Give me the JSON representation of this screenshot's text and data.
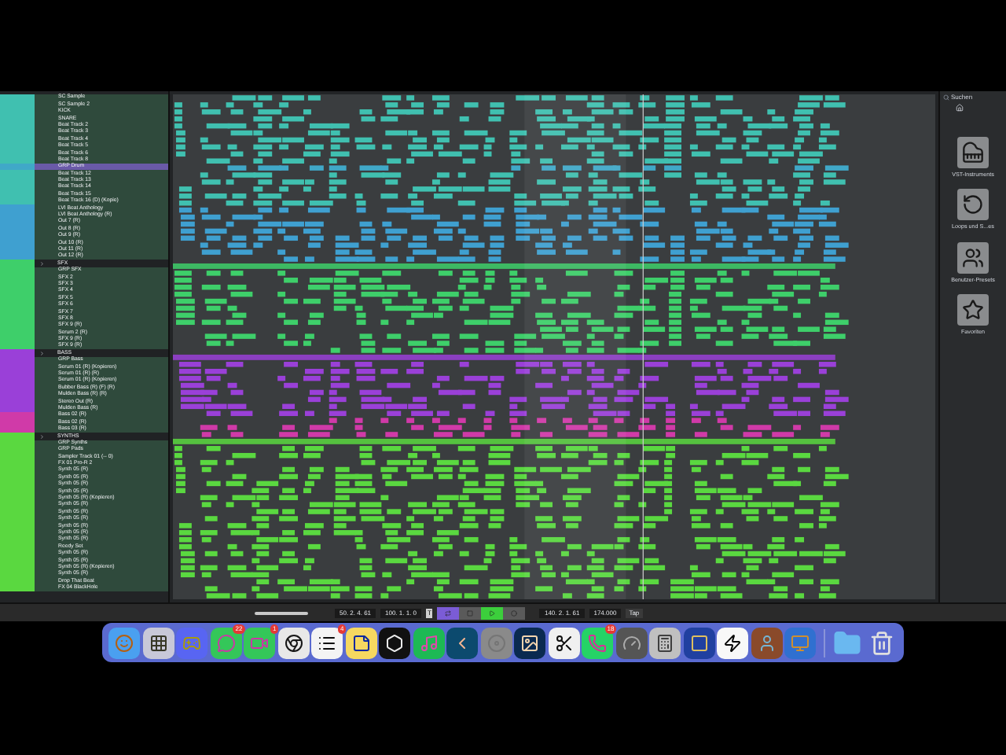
{
  "tracks": [
    {
      "name": "SC Sample",
      "kind": "track",
      "color": "#40c0b0",
      "selected": false
    },
    {
      "name": "SC Sample 2",
      "kind": "track",
      "color": "#40c0b0",
      "selected": false
    },
    {
      "name": "KICK",
      "kind": "track",
      "color": "#40c0b0",
      "selected": false
    },
    {
      "name": "SNARE",
      "kind": "track",
      "color": "#40c0b0",
      "selected": false
    },
    {
      "name": "Beat Track 2",
      "kind": "track",
      "color": "#40c0b0",
      "selected": false
    },
    {
      "name": "Beat Track 3",
      "kind": "track",
      "color": "#40c0b0",
      "selected": false
    },
    {
      "name": "Beat Track 4",
      "kind": "track",
      "color": "#40c0b0",
      "selected": false
    },
    {
      "name": "Beat Track 5",
      "kind": "track",
      "color": "#40c0b0",
      "selected": false
    },
    {
      "name": "Beat Track 6",
      "kind": "track",
      "color": "#40c0b0",
      "selected": false
    },
    {
      "name": "Beat Track 8",
      "kind": "track",
      "color": "#40c0b0",
      "selected": false
    },
    {
      "name": "GRP Drum",
      "kind": "track",
      "color": "#40a8c8",
      "selected": true
    },
    {
      "name": "Beat Track 12",
      "kind": "track",
      "color": "#40c0b0",
      "selected": false
    },
    {
      "name": "Beat Track 13",
      "kind": "track",
      "color": "#40c0b0",
      "selected": false
    },
    {
      "name": "Beat Track 14",
      "kind": "track",
      "color": "#40c0b0",
      "selected": false
    },
    {
      "name": "Beat Track 15",
      "kind": "track",
      "color": "#40c0b0",
      "selected": false
    },
    {
      "name": "Beat Track 16 (D) (Kopie)",
      "kind": "track",
      "color": "#40c0b0",
      "selected": false
    },
    {
      "name": "LVI Beat Anthology",
      "kind": "track",
      "color": "#3fa0d0",
      "selected": false
    },
    {
      "name": "LVI Beat Anthology (R)",
      "kind": "track",
      "color": "#3fa0d0",
      "selected": false
    },
    {
      "name": "Out 7 (R)",
      "kind": "track",
      "color": "#3fa0d0",
      "selected": false
    },
    {
      "name": "Out 8 (R)",
      "kind": "track",
      "color": "#3fa0d0",
      "selected": false
    },
    {
      "name": "Out 9 (R)",
      "kind": "track",
      "color": "#3fa0d0",
      "selected": false
    },
    {
      "name": "Out 10 (R)",
      "kind": "track",
      "color": "#3fa0d0",
      "selected": false
    },
    {
      "name": "Out 11 (R)",
      "kind": "track",
      "color": "#3fa0d0",
      "selected": false
    },
    {
      "name": "Out 12 (R)",
      "kind": "track",
      "color": "#3fa0d0",
      "selected": false
    },
    {
      "name": "SFX",
      "kind": "folder",
      "color": "#3ecf6a",
      "selected": false
    },
    {
      "name": "GRP SFX",
      "kind": "track",
      "color": "#3ecf6a",
      "selected": false
    },
    {
      "name": "SFX 2",
      "kind": "track",
      "color": "#3ecf6a",
      "selected": false
    },
    {
      "name": "SFX 3",
      "kind": "track",
      "color": "#3ecf6a",
      "selected": false
    },
    {
      "name": "SFX 4",
      "kind": "track",
      "color": "#3ecf6a",
      "selected": false
    },
    {
      "name": "SFX 5",
      "kind": "track",
      "color": "#3ecf6a",
      "selected": false
    },
    {
      "name": "SFX 6",
      "kind": "track",
      "color": "#3ecf6a",
      "selected": false
    },
    {
      "name": "SFX 7",
      "kind": "track",
      "color": "#3ecf6a",
      "selected": false
    },
    {
      "name": "SFX 8",
      "kind": "track",
      "color": "#3ecf6a",
      "selected": false
    },
    {
      "name": "SFX 9 (R)",
      "kind": "track",
      "color": "#3ecf6a",
      "selected": false
    },
    {
      "name": "Serum 2 (R)",
      "kind": "track",
      "color": "#3ecf6a",
      "selected": false
    },
    {
      "name": "SFX 9 (R)",
      "kind": "track",
      "color": "#3ecf6a",
      "selected": false
    },
    {
      "name": "SFX 9 (R)",
      "kind": "track",
      "color": "#3ecf6a",
      "selected": false
    },
    {
      "name": "BASS",
      "kind": "folder",
      "color": "#9a40d8",
      "selected": false
    },
    {
      "name": "GRP Bass",
      "kind": "track",
      "color": "#9a40d8",
      "selected": false
    },
    {
      "name": "Serum 01 (R) (Kopieren)",
      "kind": "track",
      "color": "#9a40d8",
      "selected": false
    },
    {
      "name": "Serum 01 (R) (R)",
      "kind": "track",
      "color": "#9a40d8",
      "selected": false
    },
    {
      "name": "Serum 01 (R) (Kopieren)",
      "kind": "track",
      "color": "#9a40d8",
      "selected": false
    },
    {
      "name": "Bubber Bass (R) (F) (R)",
      "kind": "track",
      "color": "#9a40d8",
      "selected": false
    },
    {
      "name": "Mulden Bass (R) (R)",
      "kind": "track",
      "color": "#9a40d8",
      "selected": false
    },
    {
      "name": "Stereo Out (R)",
      "kind": "track",
      "color": "#9a40d8",
      "selected": false
    },
    {
      "name": "Mulden Bass (R)",
      "kind": "track",
      "color": "#9a40d8",
      "selected": false
    },
    {
      "name": "Bass 02 (R)",
      "kind": "track",
      "color": "#d03aa8",
      "selected": false
    },
    {
      "name": "Bass 02 (R)",
      "kind": "track",
      "color": "#d03aa8",
      "selected": false
    },
    {
      "name": "Bass 03 (R)",
      "kind": "track",
      "color": "#d03aa8",
      "selected": false
    },
    {
      "name": "SYNTHS",
      "kind": "folder",
      "color": "#5ad840",
      "selected": false
    },
    {
      "name": "GRP Synths",
      "kind": "track",
      "color": "#5ad840",
      "selected": false
    },
    {
      "name": "GRP Pads",
      "kind": "track",
      "color": "#5ad840",
      "selected": false
    },
    {
      "name": "Sampler Track 01 (-- 0)",
      "kind": "track",
      "color": "#5ad840",
      "selected": false
    },
    {
      "name": "FX 01 Pro-R 2",
      "kind": "track",
      "color": "#5ad840",
      "selected": false
    },
    {
      "name": "Synth 05 (R)",
      "kind": "track",
      "color": "#5ad840",
      "selected": false
    },
    {
      "name": "Synth 05 (R)",
      "kind": "track",
      "color": "#5ad840",
      "selected": false
    },
    {
      "name": "Synth 05 (R)",
      "kind": "track",
      "color": "#5ad840",
      "selected": false
    },
    {
      "name": "Synth 05 (R)",
      "kind": "track",
      "color": "#5ad840",
      "selected": false
    },
    {
      "name": "Synth 05 (R) (Kopieren)",
      "kind": "track",
      "color": "#5ad840",
      "selected": false
    },
    {
      "name": "Synth 05 (R)",
      "kind": "track",
      "color": "#5ad840",
      "selected": false
    },
    {
      "name": "Synth 05 (R)",
      "kind": "track",
      "color": "#5ad840",
      "selected": false
    },
    {
      "name": "Synth 05 (R)",
      "kind": "track",
      "color": "#5ad840",
      "selected": false
    },
    {
      "name": "Synth 05 (R)",
      "kind": "track",
      "color": "#5ad840",
      "selected": false
    },
    {
      "name": "Synth 05 (R)",
      "kind": "track",
      "color": "#5ad840",
      "selected": false
    },
    {
      "name": "Synth 05 (R)",
      "kind": "track",
      "color": "#5ad840",
      "selected": false
    },
    {
      "name": "Reedy Set",
      "kind": "track",
      "color": "#5ad840",
      "selected": false
    },
    {
      "name": "Synth 05 (R)",
      "kind": "track",
      "color": "#5ad840",
      "selected": false
    },
    {
      "name": "Synth 05 (R)",
      "kind": "track",
      "color": "#5ad840",
      "selected": false
    },
    {
      "name": "Synth 05 (R) (Kopieren)",
      "kind": "track",
      "color": "#5ad840",
      "selected": false
    },
    {
      "name": "Synth 05 (R)",
      "kind": "track",
      "color": "#5ad840",
      "selected": false
    },
    {
      "name": "Drop That Beat",
      "kind": "track",
      "color": "#5ad840",
      "selected": false
    },
    {
      "name": "FX 04 BlackHole",
      "kind": "track",
      "color": "#5ad840",
      "selected": false
    }
  ],
  "media_panel": {
    "title": "Suchen",
    "tiles": [
      "VST-Instruments",
      "Loops und S...es",
      "Benutzer-Presets",
      "Favoriten"
    ]
  },
  "transport": {
    "left_locator": "50. 2. 4. 61",
    "right_locator": "100. 1. 1. 0",
    "time_mode": "T",
    "position": "140. 2. 1. 61",
    "tempo": "174.000",
    "tap": "Tap",
    "buttons": [
      {
        "kind": "cycle",
        "on": true
      },
      {
        "kind": "stop",
        "on": false
      },
      {
        "kind": "play",
        "on": true
      },
      {
        "kind": "record",
        "on": false
      }
    ]
  },
  "dock": {
    "badges": [
      "22",
      "1",
      "4",
      "18"
    ]
  }
}
